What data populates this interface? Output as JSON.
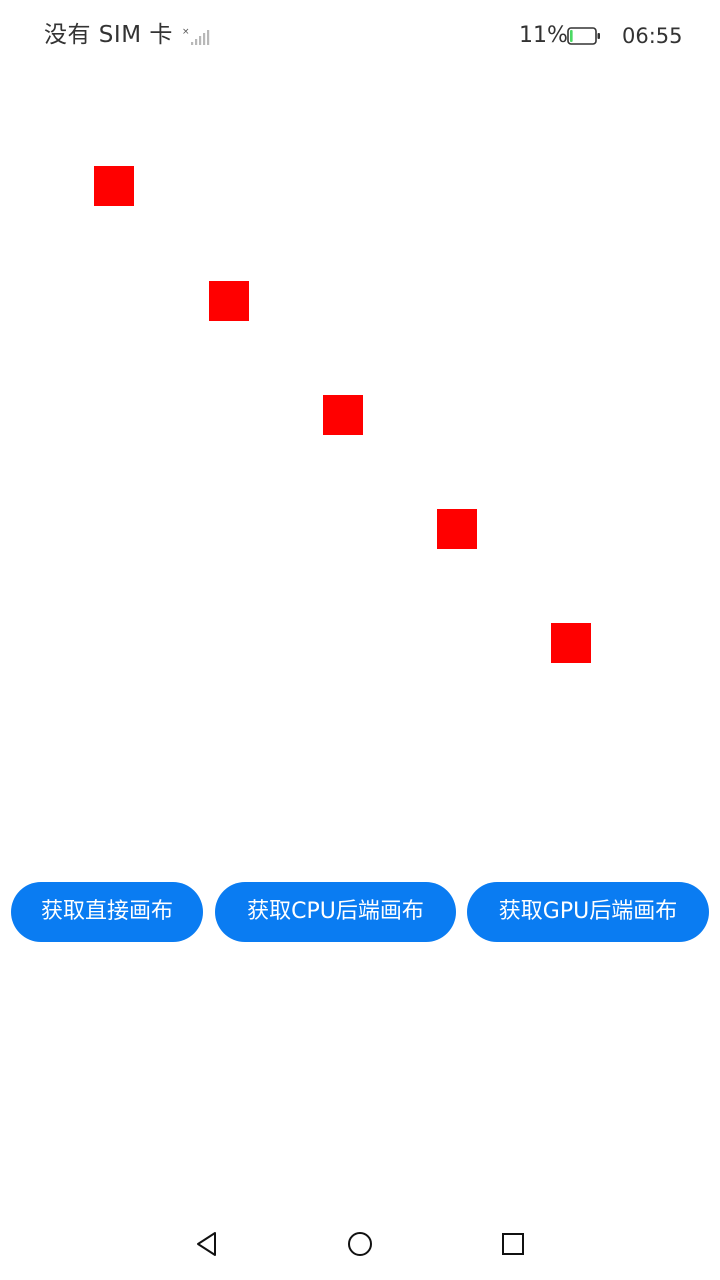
{
  "status_bar": {
    "carrier": "没有 SIM 卡",
    "signal_icon": "signal-no-sim-icon",
    "battery_percent": "11%",
    "battery_icon": "battery-low-icon",
    "battery_level": 0.11,
    "battery_color": "#4cd964",
    "time": "06:55"
  },
  "canvas": {
    "shape_color": "#ff0000",
    "shape_count": 5
  },
  "buttons": {
    "direct_canvas": "获取直接画布",
    "cpu_canvas": "获取CPU后端画布",
    "gpu_canvas": "获取GPU后端画布",
    "color": "#0a7cf2"
  },
  "nav_bar": {
    "back_icon": "back-triangle-icon",
    "home_icon": "home-circle-icon",
    "recent_icon": "recent-apps-square-icon"
  }
}
